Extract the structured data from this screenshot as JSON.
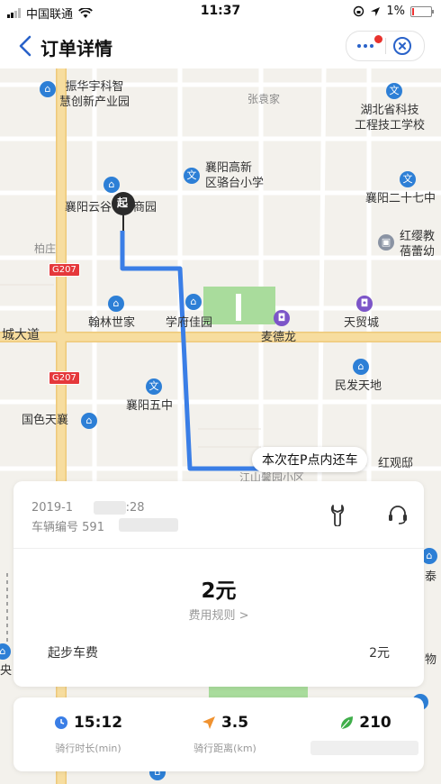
{
  "status_bar": {
    "carrier": "中国联通",
    "time": "11:37",
    "battery": "1%"
  },
  "nav": {
    "title": "订单详情"
  },
  "map": {
    "pois": [
      {
        "name": "振华宇科智\n慧创新产业园",
        "icon": "building-icon"
      },
      {
        "name": "张袁家",
        "icon": ""
      },
      {
        "name": "湖北省科技\n工程技工学校",
        "icon": "school-icon"
      },
      {
        "name": "襄阳高新\n区骆台小学",
        "icon": "school-icon"
      },
      {
        "name": "襄阳二十七中",
        "icon": "school-icon"
      },
      {
        "name": "襄阳云谷",
        "icon": "building-icon"
      },
      {
        "name": "商园",
        "icon": ""
      },
      {
        "name": "红缨教\n蓓蕾幼",
        "icon": "kindergarten-icon"
      },
      {
        "name": "柏庄",
        "icon": ""
      },
      {
        "name": "翰林世家",
        "icon": "building-icon"
      },
      {
        "name": "学府佳园",
        "icon": "building-icon"
      },
      {
        "name": "天贸城",
        "icon": "shop-icon"
      },
      {
        "name": "城大道",
        "icon": ""
      },
      {
        "name": "麦德龙",
        "icon": "shop-icon"
      },
      {
        "name": "民发天地",
        "icon": "building-icon"
      },
      {
        "name": "襄阳五中",
        "icon": "school-icon"
      },
      {
        "name": "国色天襄",
        "icon": "building-icon"
      },
      {
        "name": "红观邸",
        "icon": ""
      },
      {
        "name": "江山馨园小区",
        "icon": ""
      },
      {
        "name": "泰",
        "icon": ""
      },
      {
        "name": "物",
        "icon": ""
      },
      {
        "name": "央",
        "icon": ""
      }
    ],
    "road_badges": [
      "G207",
      "G207"
    ],
    "start_marker": "起",
    "return_tip": "本次在P点内还车"
  },
  "order": {
    "date": "2019-1",
    "time": "13:28",
    "vehicle_label": "车辆编号",
    "vehicle_number": "591",
    "vehicle_suffix": "0",
    "amount": "2元",
    "fee_rule": "费用规则 >",
    "base_fee_label": "起步车费",
    "base_fee_value": "2元"
  },
  "stats": {
    "duration_value": "15:12",
    "duration_label": "骑行时长(min)",
    "distance_value": "3.5",
    "distance_label": "骑行距离(km)",
    "carbon_value": "210"
  },
  "colors": {
    "route": "#3a7ee6",
    "accent_blue": "#2962c9",
    "badge_red": "#e5383b",
    "main_road": "#f4d89a"
  }
}
